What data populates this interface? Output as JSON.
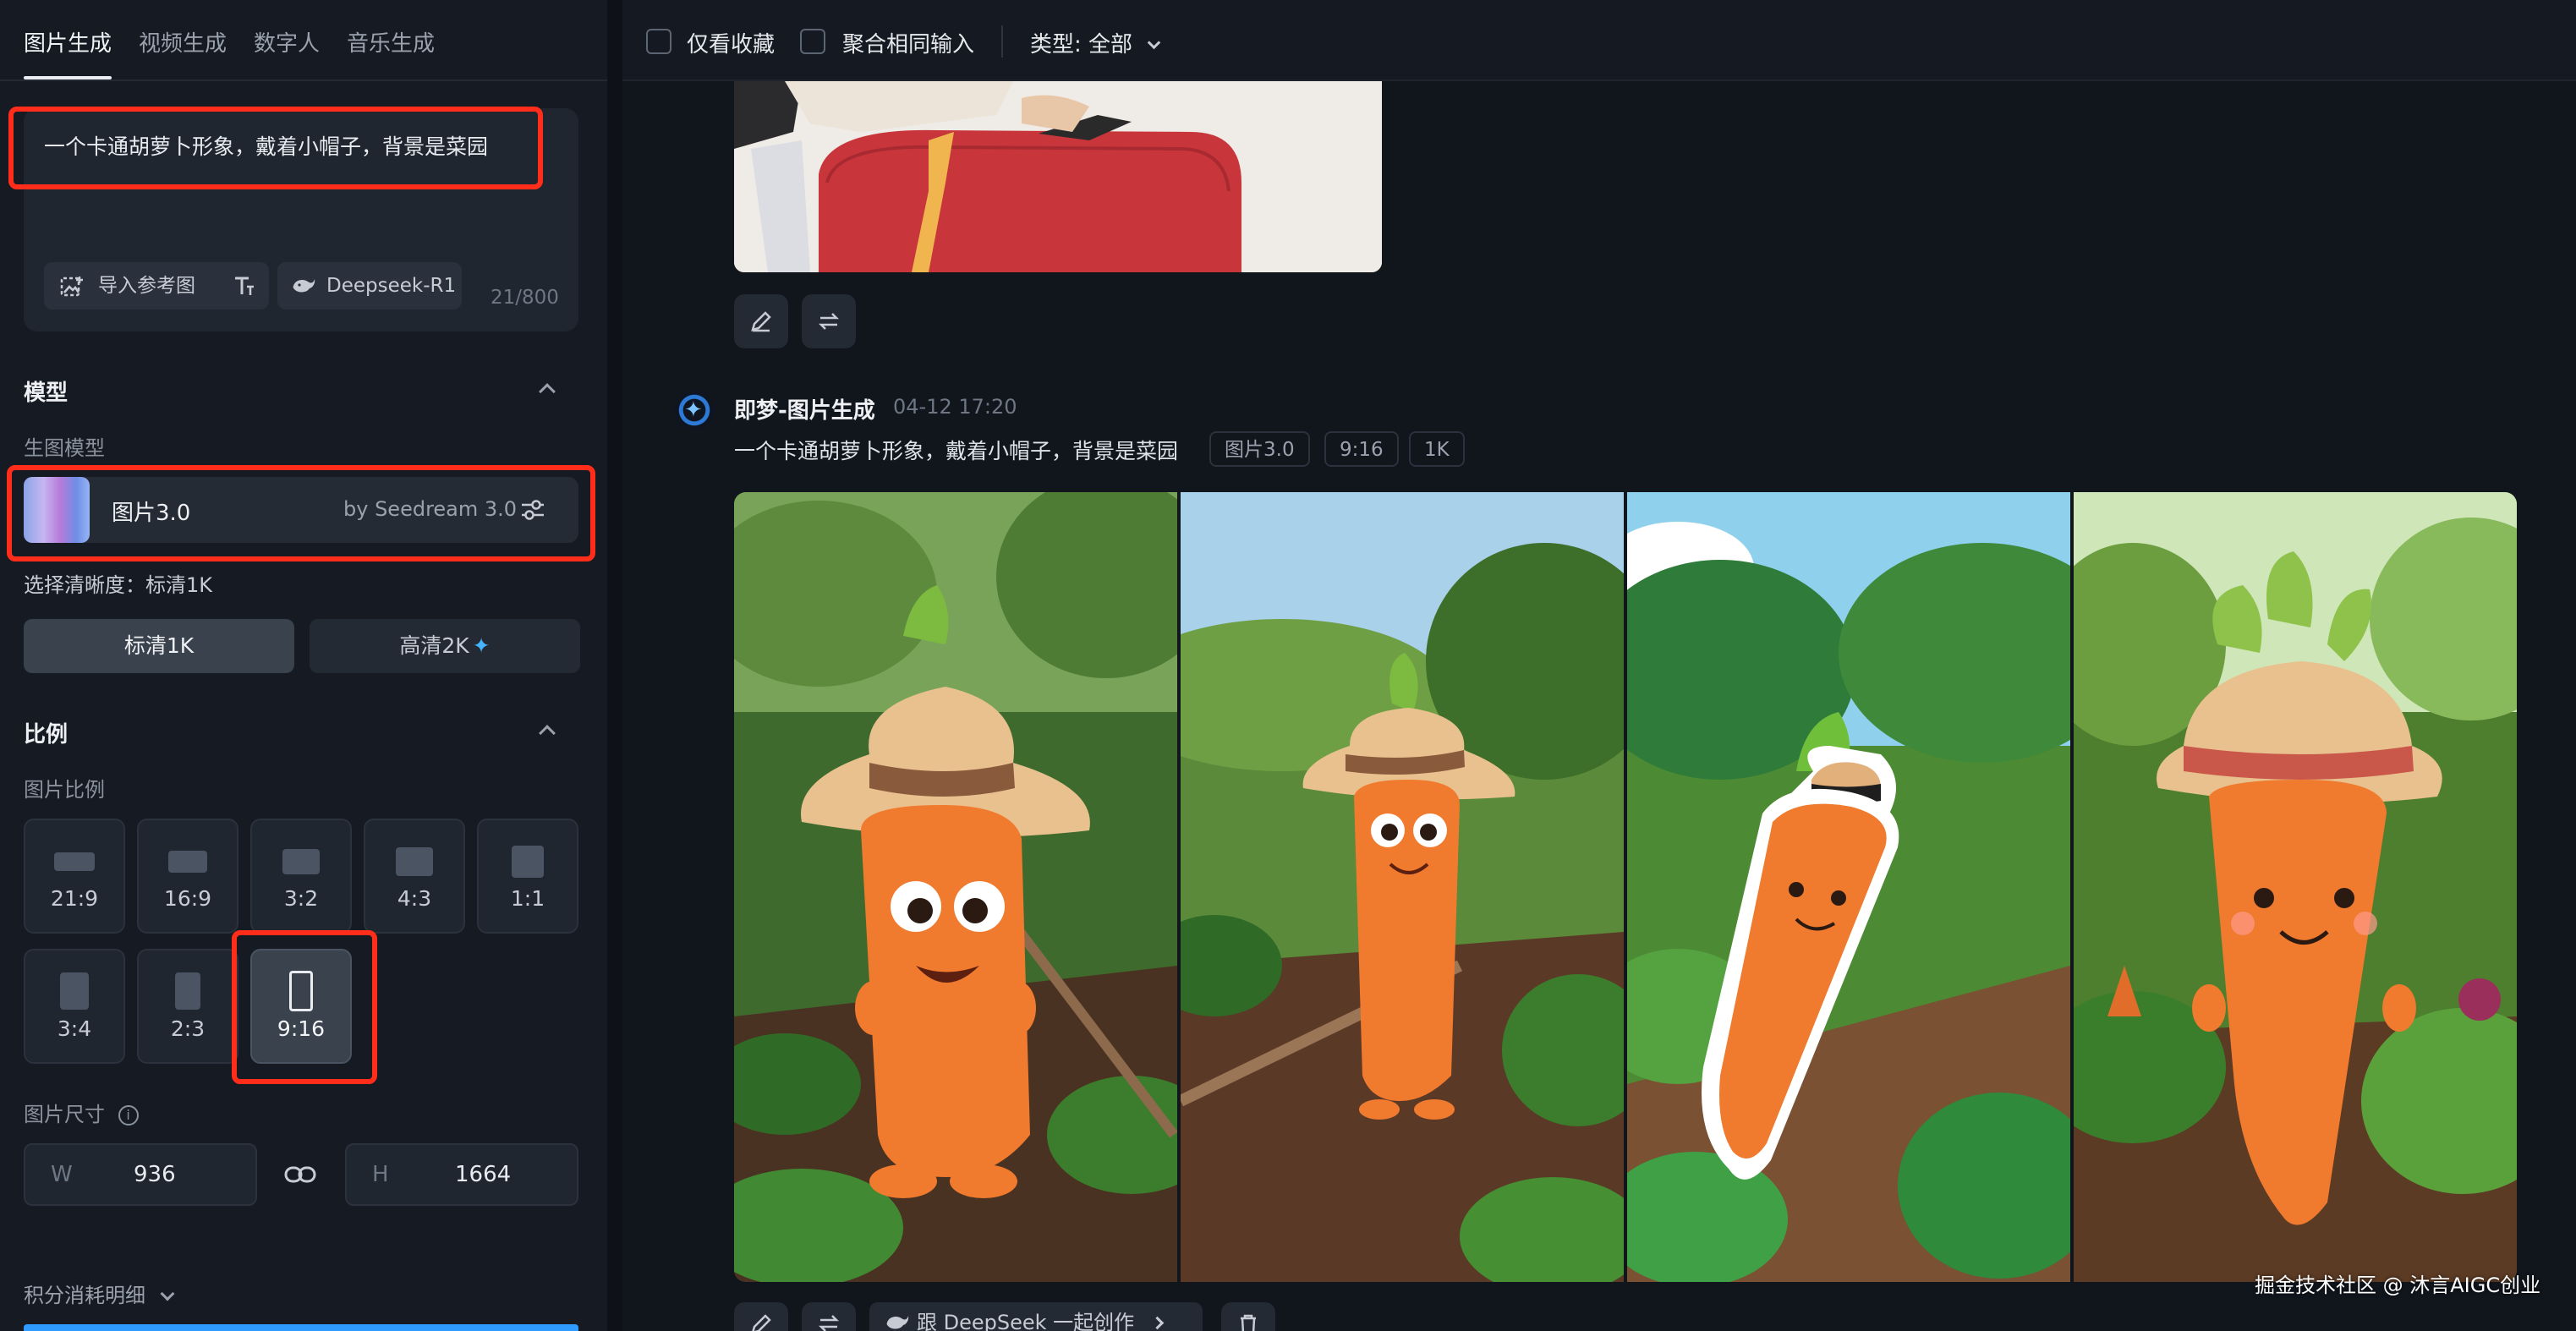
{
  "tabs": [
    "图片生成",
    "视频生成",
    "数字人",
    "音乐生成"
  ],
  "prompt": {
    "text": "一个卡通胡萝卜形象，戴着小帽子，背景是菜园",
    "ref_button": "导入参考图",
    "model_chip": "Deepseek-R1",
    "counter": "21/800"
  },
  "model_section": {
    "title": "模型",
    "sub_label": "生图模型",
    "model_name": "图片3.0",
    "model_by": "by Seedream 3.0",
    "resolution_label": "选择清晰度：标清1K",
    "res_options": [
      "标清1K",
      "高清2K"
    ]
  },
  "ratio_section": {
    "title": "比例",
    "sub_label": "图片比例",
    "ratios": [
      "21:9",
      "16:9",
      "3:2",
      "4:3",
      "1:1",
      "3:4",
      "2:3",
      "9:16"
    ],
    "selected": "9:16",
    "size_label": "图片尺寸",
    "width_label": "W",
    "width_value": "936",
    "height_label": "H",
    "height_value": "1664"
  },
  "credits_label": "积分消耗明细",
  "topbar": {
    "fav_only": "仅看收藏",
    "merge_inputs": "聚合相同输入",
    "type_filter": "类型: 全部"
  },
  "message": {
    "title": "即梦-图片生成",
    "time": "04-12  17:20",
    "text": "一个卡通胡萝卜形象，戴着小帽子，背景是菜园",
    "tags": [
      "图片3.0",
      "9:16",
      "1K"
    ]
  },
  "bottom_pill": "跟 DeepSeek 一起创作",
  "watermark": "掘金技术社区 @ 沐言AIGC创业",
  "colors": {
    "highlight": "#ff2d1a",
    "accent_blue": "#2f9bff",
    "carrot": "#f07a2e",
    "hat": "#e8c18e"
  }
}
